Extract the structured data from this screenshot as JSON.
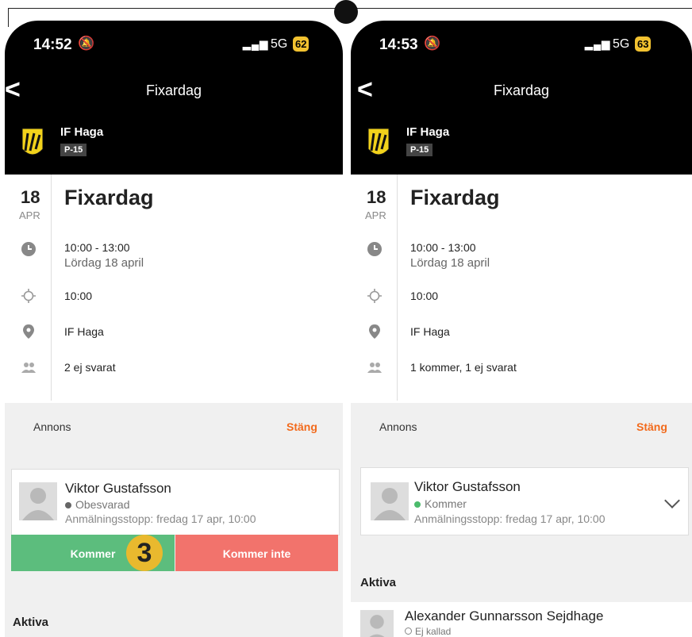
{
  "header_badge": "",
  "left": {
    "status": {
      "time": "14:52",
      "network": "5G",
      "battery": "62"
    },
    "nav": {
      "back_label": "<",
      "title": "Fixardag"
    },
    "team": {
      "name": "IF Haga",
      "tag": "P-15"
    },
    "event": {
      "day": "18",
      "month": "APR",
      "title": "Fixardag",
      "time_range": "10:00 - 13:00",
      "date_text": "Lördag 18 april",
      "gather_time": "10:00",
      "location": "IF Haga",
      "attendance": "2 ej svarat"
    },
    "annons": {
      "label": "Annons",
      "close_label": "Stäng"
    },
    "player": {
      "name": "Viktor Gustafsson",
      "status": "Obesvarad",
      "status_color": "#666666",
      "deadline": "Anmälningsstopp: fredag 17 apr, 10:00"
    },
    "actions": {
      "yes_label": "Kommer",
      "no_label": "Kommer inte",
      "step_badge": "3"
    },
    "aktiva_label": "Aktiva"
  },
  "right": {
    "status": {
      "time": "14:53",
      "network": "5G",
      "battery": "63"
    },
    "nav": {
      "back_label": "<",
      "title": "Fixardag"
    },
    "team": {
      "name": "IF Haga",
      "tag": "P-15"
    },
    "event": {
      "day": "18",
      "month": "APR",
      "title": "Fixardag",
      "time_range": "10:00 - 13:00",
      "date_text": "Lördag 18 april",
      "gather_time": "10:00",
      "location": "IF Haga",
      "attendance": "1 kommer, 1 ej svarat"
    },
    "annons": {
      "label": "Annons",
      "close_label": "Stäng"
    },
    "player": {
      "name": "Viktor Gustafsson",
      "status": "Kommer",
      "status_color": "#4cbb6c",
      "deadline": "Anmälningsstopp: fredag 17 apr, 10:00"
    },
    "aktiva_label": "Aktiva",
    "member": {
      "name": "Alexander Gunnarsson Sejdhage",
      "status": "Ej kallad"
    }
  },
  "colors": {
    "accent": "#f26a1b",
    "yes": "#5cbd7d",
    "no": "#f2736c",
    "highlight": "#e9b92e"
  }
}
